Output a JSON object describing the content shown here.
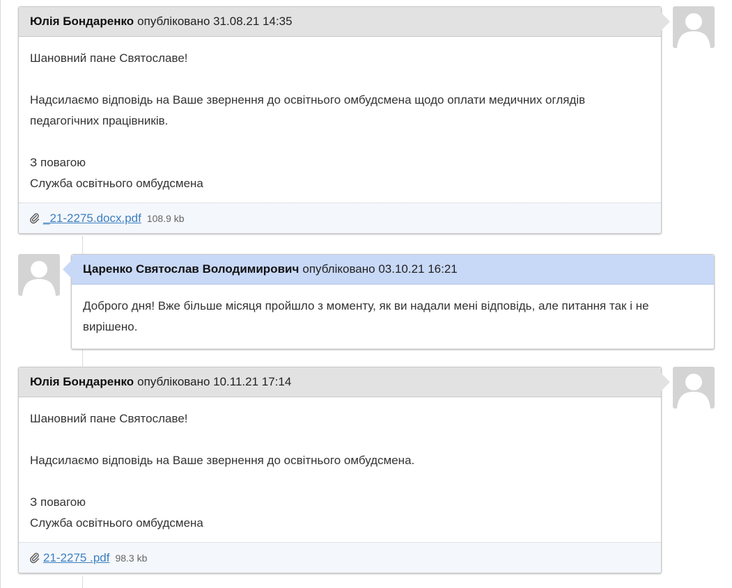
{
  "messages": [
    {
      "author": "Юлія Бондаренко",
      "meta": "опубліковано 31.08.21 14:35",
      "lines": [
        "Шановний пане Святославе!",
        "",
        "Надсилаємо відповідь на Ваше звернення до освітнього омбудсмена щодо оплати медичних оглядів",
        "педагогічних працівників.",
        "",
        "З повагою",
        "Служба освітнього омбудсмена"
      ],
      "attachment": {
        "name": "_21-2275.docx.pdf",
        "size": "108.9 kb"
      }
    },
    {
      "author": "Царенко Святослав Володимирович",
      "meta": "опубліковано 03.10.21 16:21",
      "lines": [
        "Доброго дня! Вже більше місяця пройшло з моменту, як ви надали мені відповідь, але питання так і не",
        "вирішено."
      ]
    },
    {
      "author": "Юлія Бондаренко",
      "meta": "опубліковано 10.11.21 17:14",
      "lines": [
        "Шановний пане Святославе!",
        "",
        "Надсилаємо відповідь на Ваше звернення до освітнього омбудсмена.",
        "",
        "З повагою",
        "Служба освітнього омбудсмена"
      ],
      "attachment": {
        "name": "21-2275 .pdf",
        "size": "98.3 kb"
      }
    }
  ],
  "colors": {
    "official_header": "#e2e2e2",
    "citizen_header": "#c8d8f7",
    "link": "#3d7fc1"
  },
  "icons": [
    "paperclip-icon",
    "user-avatar-icon"
  ]
}
